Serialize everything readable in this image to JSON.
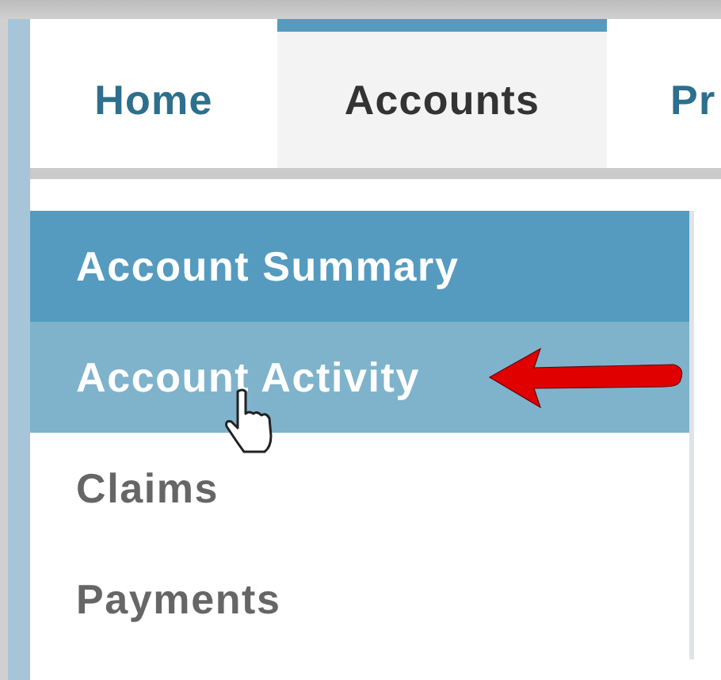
{
  "tabs": [
    {
      "label": "Home",
      "selected": false
    },
    {
      "label": "Accounts",
      "selected": true
    },
    {
      "label": "Pr",
      "selected": false
    }
  ],
  "menu": {
    "items": [
      {
        "label": "Account Summary",
        "selected": true,
        "hovered": false
      },
      {
        "label": "Account Activity",
        "selected": false,
        "hovered": true
      },
      {
        "label": "Claims",
        "selected": false,
        "hovered": false
      },
      {
        "label": "Payments",
        "selected": false,
        "hovered": false
      }
    ]
  }
}
